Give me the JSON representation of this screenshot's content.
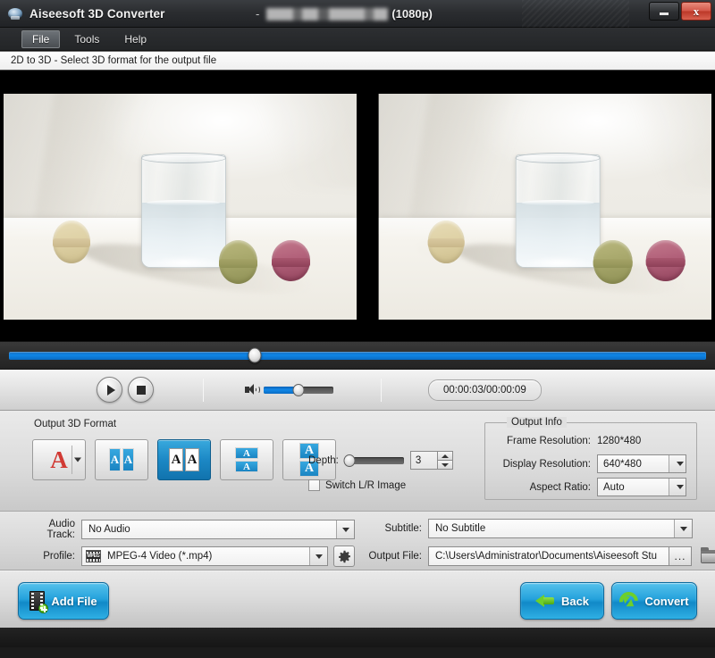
{
  "window": {
    "app_title": "Aiseesoft 3D Converter",
    "title_separator": "-",
    "title_redacted_filename": "",
    "title_resolution": "(1080p)",
    "minimize_label": "minimize",
    "close_label": "x"
  },
  "menu": {
    "items": [
      {
        "label": "File",
        "active": true
      },
      {
        "label": "Tools",
        "active": false
      },
      {
        "label": "Help",
        "active": false
      }
    ]
  },
  "hint": {
    "text": "2D to 3D - Select 3D format for the output file"
  },
  "preview": {
    "left_pane_label": "left-eye-preview",
    "right_pane_label": "right-eye-preview"
  },
  "transport": {
    "play_label": "Play",
    "stop_label": "Stop",
    "time_display": "00:00:03/00:00:09",
    "seek_position_percent": 35,
    "volume_percent": 50
  },
  "output_3d_format": {
    "section_label": "Output 3D Format",
    "buttons": [
      {
        "name": "anaglyph",
        "glyph": "A",
        "selected": false,
        "has_dropdown": true
      },
      {
        "name": "side-by-side-half-width",
        "glyph": "A",
        "selected": false,
        "has_dropdown": false
      },
      {
        "name": "side-by-side-full",
        "glyph": "A",
        "selected": true,
        "has_dropdown": false
      },
      {
        "name": "top-and-bottom-half-height",
        "glyph": "A",
        "selected": false,
        "has_dropdown": false
      },
      {
        "name": "top-and-bottom-full",
        "glyph": "A",
        "selected": false,
        "has_dropdown": false
      }
    ],
    "depth_label": "Depth:",
    "depth_value": "3",
    "depth_slider_percent": 8,
    "switch_lr_label": "Switch L/R Image",
    "switch_lr_checked": false
  },
  "output_info": {
    "group_title": "Output Info",
    "frame_resolution_label": "Frame Resolution:",
    "frame_resolution_value": "1280*480",
    "display_resolution_label": "Display Resolution:",
    "display_resolution_value": "640*480",
    "aspect_ratio_label": "Aspect Ratio:",
    "aspect_ratio_value": "Auto"
  },
  "settings_rows": {
    "audio_track_label": "Audio Track:",
    "audio_track_value": "No Audio",
    "profile_label": "Profile:",
    "profile_value": "MPEG-4 Video (*.mp4)",
    "profile_icon_text": "MPEG",
    "settings_button_name": "gear-icon",
    "subtitle_label": "Subtitle:",
    "subtitle_value": "No Subtitle",
    "output_file_label": "Output File:",
    "output_file_value": "C:\\Users\\Administrator\\Documents\\Aiseesoft Stu",
    "browse_dots_label": "...",
    "open_folder_name": "folder-icon"
  },
  "actions": {
    "add_file_label": "Add File",
    "back_label": "Back",
    "convert_label": "Convert"
  },
  "colors": {
    "accent_blue": "#1189c8",
    "accent_green": "#6ecf2b",
    "selected_format": "#1c88c5",
    "seek_blue": "#0f86e8",
    "close_red": "#bc3828"
  }
}
